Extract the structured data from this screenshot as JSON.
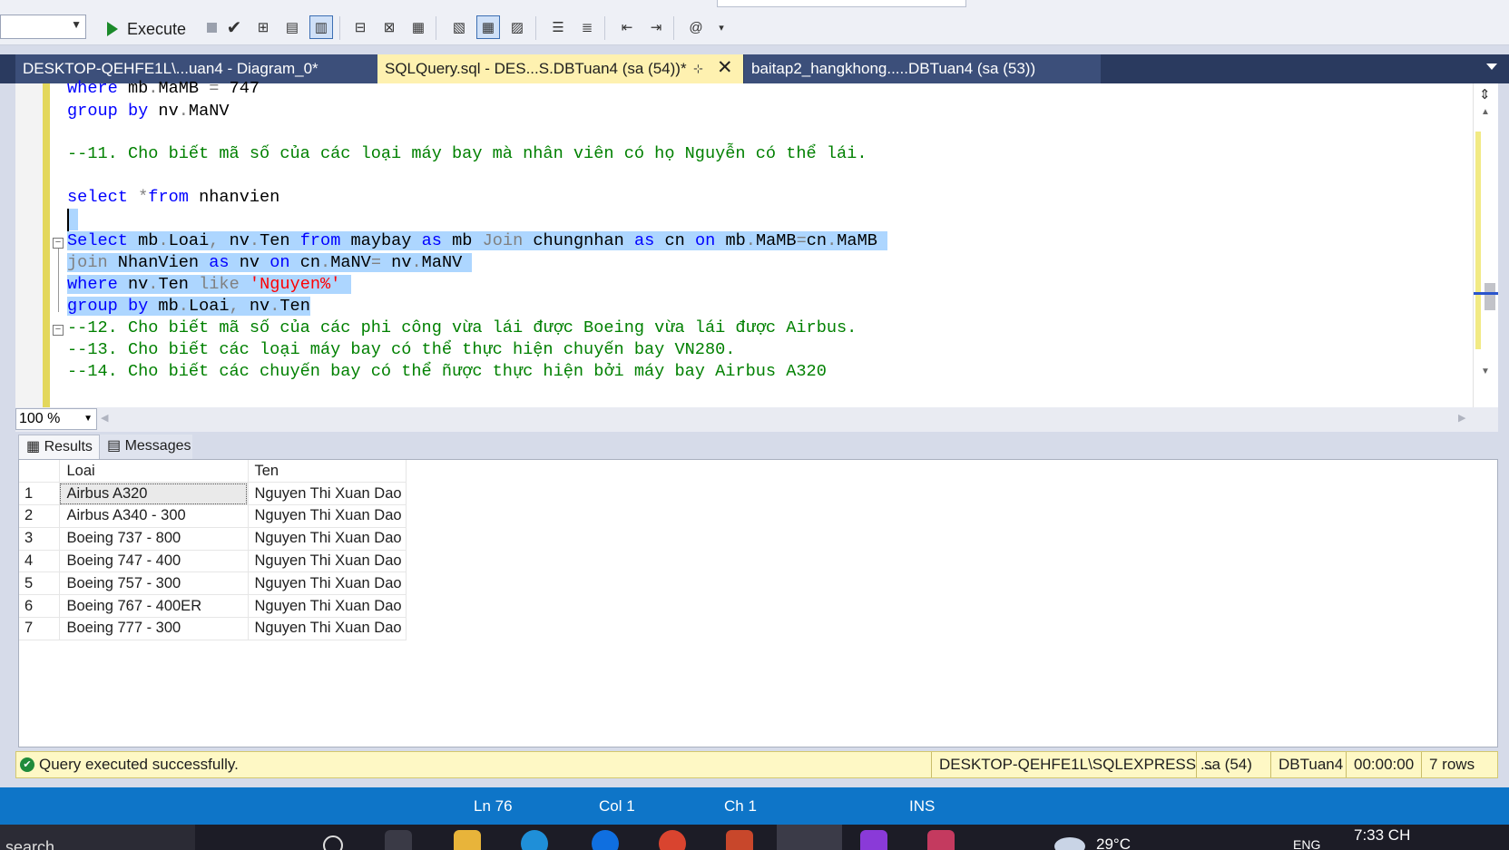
{
  "toolbar": {
    "execute_label": "Execute"
  },
  "tabs": [
    {
      "label": "DESKTOP-QEHFE1L\\...uan4 - Diagram_0*"
    },
    {
      "label": "SQLQuery.sql - DES...S.DBTuan4 (sa (54))*",
      "pin": "⊹",
      "close": "✕"
    },
    {
      "label": "baitap2_hangkhong.....DBTuan4 (sa (53))"
    }
  ],
  "editor": {
    "l1": {
      "a": "where",
      "b": " mb",
      "c": ".",
      "d": "MaMB ",
      "e": "=",
      "f": " 747"
    },
    "l2": {
      "a": "group by",
      "b": " nv",
      "c": ".",
      "d": "MaNV"
    },
    "l3": "--11. Cho biết mã số của các loại máy bay mà nhân viên có họ Nguyễn có thể lái.",
    "l4": {
      "a": "select",
      "b": " *",
      "c": "from",
      "d": " nhanvien"
    },
    "l6": {
      "a": "Select",
      "b": " mb",
      "c": ".",
      "d": "Loai",
      "e": ",",
      "f": " nv",
      "g": ".",
      "h": "Ten ",
      "i": "from",
      "j": " maybay ",
      "k": "as",
      "l": " mb ",
      "m": "Join",
      "n": " chungnhan ",
      "o": "as",
      "p": " cn ",
      "q": "on",
      "r": " mb",
      "s": ".",
      "t": "MaMB",
      "u": "=",
      "v": "cn",
      "w": ".",
      "x": "MaMB "
    },
    "l7": {
      "a": "join",
      "b": " NhanVien ",
      "c": "as",
      "d": " nv ",
      "e": "on",
      "f": " cn",
      "g": ".",
      "h": "MaNV",
      "i": "=",
      "j": " nv",
      "k": ".",
      "l": "MaNV "
    },
    "l8": {
      "a": "where",
      "b": " nv",
      "c": ".",
      "d": "Ten ",
      "e": "like",
      "f": " ",
      "g": "'Nguyen%'",
      "h": " "
    },
    "l9": {
      "a": "group by",
      "b": " mb",
      "c": ".",
      "d": "Loai",
      "e": ",",
      "f": " nv",
      "g": ".",
      "h": "Ten"
    },
    "l10": "--12. Cho biết mã số của các phi công vừa lái được Boeing vừa lái được Airbus.",
    "l11": "--13. Cho biết các loại máy bay có thể thực hiện chuyến bay VN280.",
    "l12": "--14. Cho biết các chuyến bay có thể ñược thực hiện bởi máy bay Airbus A320"
  },
  "zoom": "100 %",
  "results_tabs": {
    "results": "Results",
    "messages": "Messages"
  },
  "grid": {
    "columns": [
      "Loai",
      "Ten"
    ],
    "rows": [
      {
        "n": "1",
        "loai": "Airbus A320",
        "ten": "Nguyen Thi Xuan Dao"
      },
      {
        "n": "2",
        "loai": "Airbus A340 - 300",
        "ten": "Nguyen Thi Xuan Dao"
      },
      {
        "n": "3",
        "loai": "Boeing 737 - 800",
        "ten": "Nguyen Thi Xuan Dao"
      },
      {
        "n": "4",
        "loai": "Boeing 747 - 400",
        "ten": "Nguyen Thi Xuan Dao"
      },
      {
        "n": "5",
        "loai": "Boeing 757 - 300",
        "ten": "Nguyen Thi Xuan Dao"
      },
      {
        "n": "6",
        "loai": "Boeing 767 - 400ER",
        "ten": "Nguyen Thi Xuan Dao"
      },
      {
        "n": "7",
        "loai": "Boeing 777 - 300",
        "ten": "Nguyen Thi Xuan Dao"
      }
    ]
  },
  "query_status": {
    "message": "Query executed successfully.",
    "server": "DESKTOP-QEHFE1L\\SQLEXPRESS ...",
    "user": "sa (54)",
    "database": "DBTuan4",
    "elapsed": "00:00:00",
    "rows": "7 rows"
  },
  "statusbar": {
    "ln": "Ln 76",
    "col": "Col 1",
    "ch": "Ch 1",
    "mode": "INS"
  },
  "taskbar": {
    "search": "search",
    "weather": "29°C",
    "lang": "ENG",
    "time": "7:33 CH"
  },
  "colors": {
    "accent": "#0e75c8",
    "active_tab": "#fef1b0",
    "selection": "#add6ff",
    "keyword": "#0000ff",
    "comment": "#008000",
    "string": "#ff0000"
  }
}
